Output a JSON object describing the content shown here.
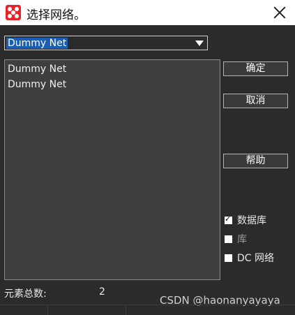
{
  "window": {
    "title": "选择网络。"
  },
  "network_select": {
    "selected": "Dummy Net"
  },
  "network_list": {
    "items": [
      "Dummy Net",
      "Dummy Net"
    ]
  },
  "buttons": {
    "ok": "确定",
    "cancel": "取消",
    "help": "帮助"
  },
  "filters": [
    {
      "label": "数据库",
      "checked": true,
      "enabled": true
    },
    {
      "label": "库",
      "checked": false,
      "enabled": false
    },
    {
      "label": "DC 网络",
      "checked": false,
      "enabled": true
    }
  ],
  "status": {
    "element_count_label": "元素总数:",
    "element_count": "2"
  },
  "watermark": "CSDN @haonanyayaya",
  "colors": {
    "window_bg": "#2b2b2b",
    "list_bg": "#3f3f3f",
    "selection": "#1a5fb4",
    "app_icon": "#e8242b"
  }
}
